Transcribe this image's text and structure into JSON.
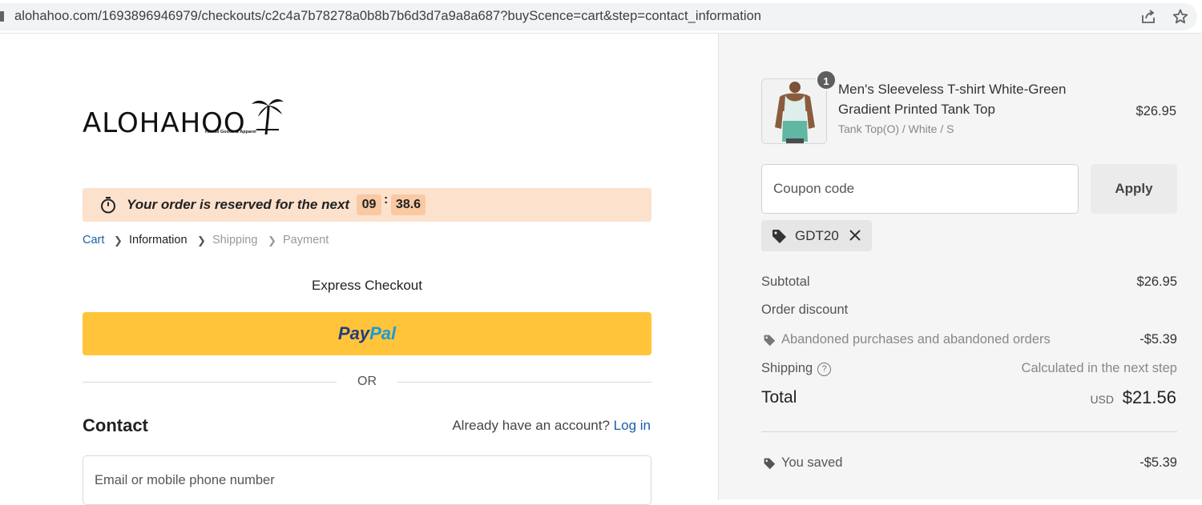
{
  "browser": {
    "url": "alohahoo.com/1693896946979/checkouts/c2c4a7b78278a0b8b7b6d3d7a9a8a687?buyScence=cart&step=contact_information",
    "icons": [
      "share-icon",
      "star-icon"
    ]
  },
  "brand": {
    "logo_text": "ALOHAHOO",
    "logo_subtitle": "Hawaii Goods & Apparel"
  },
  "reservation": {
    "message": "Your order is reserved for the next",
    "minutes": "09",
    "seconds": "38.6",
    "separator": ":"
  },
  "breadcrumb": {
    "cart": "Cart",
    "information": "Information",
    "shipping": "Shipping",
    "payment": "Payment"
  },
  "express": {
    "title": "Express Checkout",
    "paypal_part1": "Pay",
    "paypal_part2": "Pal",
    "or_label": "OR"
  },
  "contact": {
    "title": "Contact",
    "account_prompt": "Already have an account?",
    "login_link": "Log in",
    "email_placeholder": "Email or mobile phone number"
  },
  "order": {
    "item": {
      "quantity": "1",
      "name": "Men's Sleeveless T-shirt White-Green Gradient Printed Tank Top",
      "variant": "Tank Top(O) / White / S",
      "price": "$26.95"
    },
    "coupon_placeholder": "Coupon code",
    "apply_label": "Apply",
    "applied_code": "GDT20",
    "subtotal_label": "Subtotal",
    "subtotal_value": "$26.95",
    "order_discount_label": "Order discount",
    "discount_name": "Abandoned purchases and abandoned orders",
    "discount_value": "-$5.39",
    "shipping_label": "Shipping",
    "shipping_value": "Calculated in the next step",
    "total_label": "Total",
    "total_currency": "USD",
    "total_value": "$21.56",
    "saved_label": "You saved",
    "saved_value": "-$5.39"
  },
  "colors": {
    "paypal_button": "#ffc439",
    "reserve_banner": "#fce1cd",
    "link_blue": "#1a5ea8"
  }
}
